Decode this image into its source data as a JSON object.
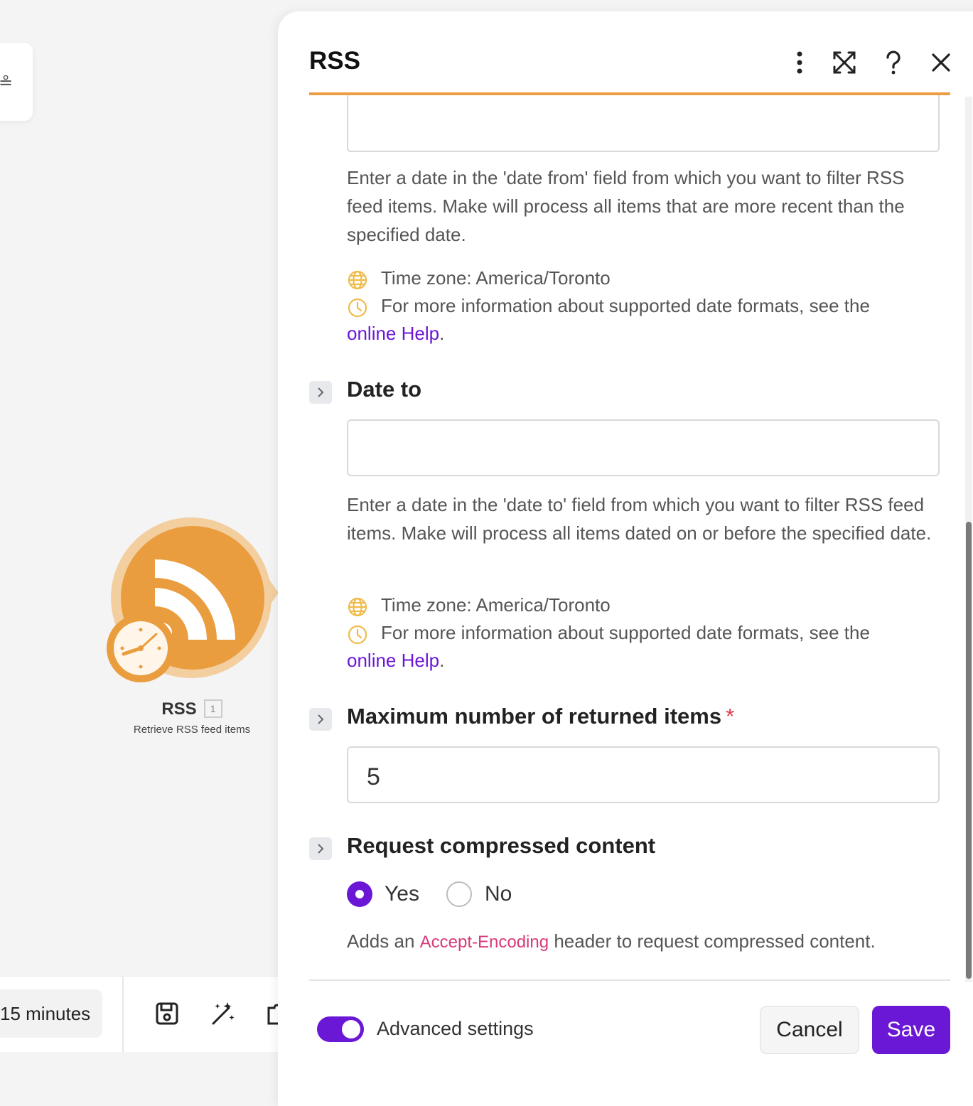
{
  "panel": {
    "title": "RSS",
    "header_buttons": [
      "more-vertical-icon",
      "fullscreen-icon",
      "help-icon",
      "close-icon"
    ]
  },
  "date_from": {
    "value": "",
    "help": "Enter a date in the 'date from' field from which you want to filter RSS feed items. Make will process all items that are more recent than the specified date.",
    "timezone": "Time zone: America/Toronto",
    "formats_text": "For more information about supported date formats, see the",
    "link": "online Help",
    "link_suffix": "."
  },
  "date_to": {
    "label": "Date to",
    "value": "",
    "help": "Enter a date in the 'date to' field from which you want to filter RSS feed items. Make will process all items dated on or before the specified date.",
    "timezone": "Time zone: America/Toronto",
    "formats_text": "For more information about supported date formats, see the",
    "link": "online Help",
    "link_suffix": "."
  },
  "max_items": {
    "label": "Maximum number of returned items",
    "required_mark": "*",
    "value": "5"
  },
  "compressed": {
    "label": "Request compressed content",
    "options": [
      {
        "label": "Yes",
        "selected": true
      },
      {
        "label": "No",
        "selected": false
      }
    ],
    "help_prefix": "Adds an",
    "help_code": "Accept-Encoding",
    "help_suffix": "header to request compressed content."
  },
  "footer": {
    "advanced_label": "Advanced settings",
    "advanced_on": true,
    "cancel": "Cancel",
    "save": "Save"
  },
  "canvas": {
    "module_name": "RSS",
    "module_badge": "1",
    "module_subtitle": "Retrieve RSS feed items",
    "schedule": "15 minutes",
    "toolbar_icons": [
      "save-icon",
      "magic-wand-icon",
      "puzzle-icon"
    ]
  },
  "colors": {
    "accent": "#6a17d6",
    "brand_orange": "#ec9d42",
    "required": "#e0364a",
    "code": "#d83a7a"
  }
}
